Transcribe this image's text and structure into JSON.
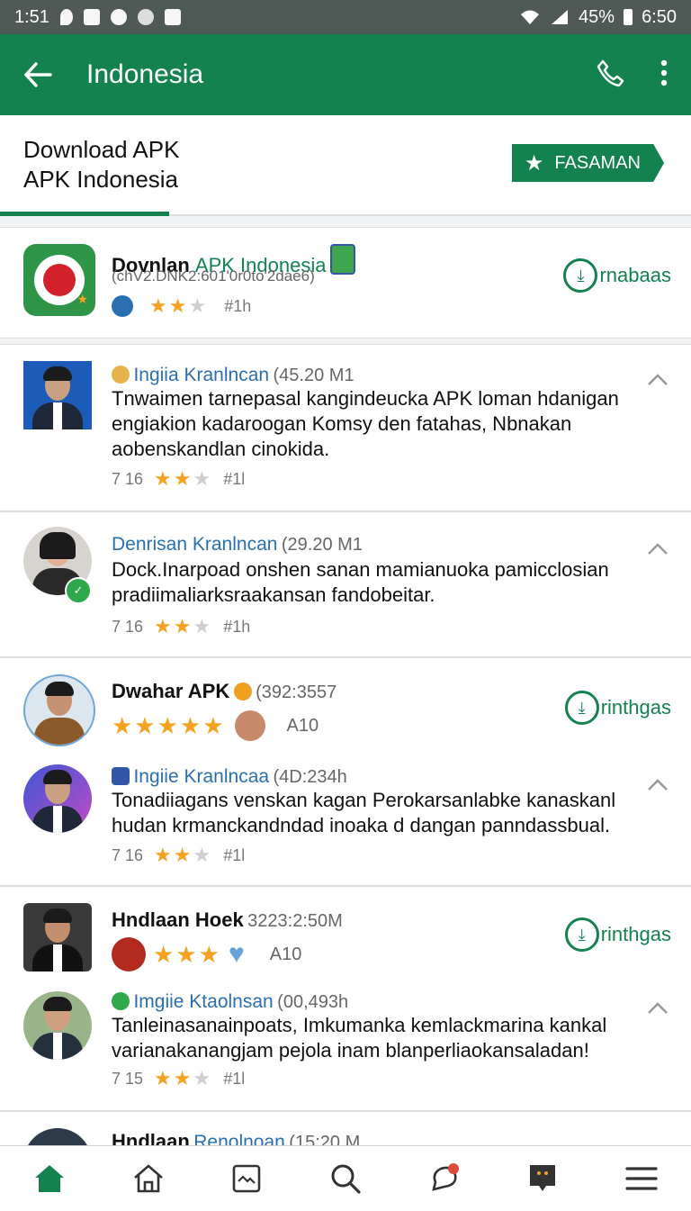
{
  "status_bar": {
    "time_left": "1:51",
    "battery": "45%",
    "time_right": "6:50"
  },
  "appbar": {
    "title": "Indonesia"
  },
  "header": {
    "title_line1": "Download APK",
    "title_line2": "APK Indonesia",
    "favorite_label": "FASAMAN"
  },
  "app": {
    "name_bold": "Dovnlan",
    "name_green": "APK Indonesia",
    "subtitle": "(chV2.DNK2:601'0r0to'2dae6)",
    "rating_count": "#1h",
    "install_label": "rnabaas",
    "colors": {
      "primary": "#13824f",
      "star": "#f4a21f"
    }
  },
  "reviews": [
    {
      "name": "Ingiia Kranlncan",
      "meta": "(45.20 M1",
      "text_line1": "Tnwaimen tarnepasal kangindeucka APK loman hdanigan",
      "text_line2": "engiakion kadaroogan Komsy den fatahas, Nbnakan",
      "text_line3": "aobenskandlan cinokida.",
      "footer_num": "7 16",
      "footer_count": "#1l"
    },
    {
      "name": "Denrisan Kranlncan",
      "meta": "(29.20 M1",
      "text_line1": "Dock.Inarpoad onshen sanan mamianuoka pamicclosian",
      "text_line2": "pradiimaliarksraakansan fandobeitar.",
      "footer_num": "7 16",
      "footer_count": "#1h"
    }
  ],
  "app2": {
    "name": "Dwahar APK",
    "meta": "(392:3557",
    "rating_label": "A10",
    "install_label": "rinthgas"
  },
  "review3": {
    "name": "Ingiie Kranlncaa",
    "meta": "(4D:234h",
    "text_line1": "Tonadiiagans venskan kagan Perokarsanlabke kanaskanl",
    "text_line2": "hudan krmanckandndad inoaka d dangan panndassbual.",
    "footer_num": "7 16",
    "footer_count": "#1l"
  },
  "app3": {
    "name": "Hndlaan Hoek",
    "meta": "3223:2:50M",
    "rating_label": "A10",
    "install_label": "rinthgas"
  },
  "review4": {
    "name": "Imgiie Ktaolnsan",
    "meta": "(00,493h",
    "text_line1": "Tanleinasanainpoats, Imkumanka kemlackmarina kankal",
    "text_line2": "varianakanangjam pejola inam blanperliaokansaladan!",
    "footer_num": "7 15",
    "footer_count": "#1l"
  },
  "partial": {
    "name": "Hndlaan",
    "name_blue": "Renolnoan",
    "meta": "(15:20 M"
  },
  "bottom_nav": [
    "home-filled-icon",
    "home-outline-icon",
    "image-icon",
    "search-icon",
    "chat-notification-icon",
    "message-icon",
    "menu-icon"
  ]
}
